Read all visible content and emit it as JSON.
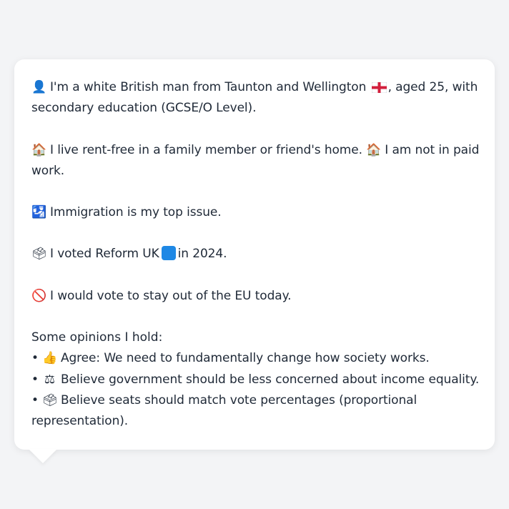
{
  "card": {
    "identity": {
      "icon": "bust-in-silhouette-icon",
      "glyph": "👤",
      "text_before_flag": "I'm a white British man from Taunton and Wellington",
      "flag": "england-flag-icon",
      "text_after_flag": ", aged 25, with secondary education (GCSE/O Level)."
    },
    "housing": {
      "icon": "house-icon",
      "glyph": "🏠",
      "text": "I live rent-free in a family member or friend's home.",
      "icon2": "house-icon",
      "glyph2": "🏠",
      "text2": "I am not in paid work."
    },
    "issue": {
      "icon": "passport-control-icon",
      "glyph": "🛂",
      "text": "Immigration is my top issue."
    },
    "vote": {
      "icon": "ballot-box-icon",
      "glyph": "🗳",
      "text_before": "I voted Reform UK",
      "party_color": "#1e88e5",
      "text_after": "in 2024."
    },
    "eu": {
      "icon": "prohibited-icon",
      "glyph": "🚫",
      "text": "I would vote to stay out of the EU today."
    },
    "opinions_intro": "Some opinions I hold:",
    "opinions": [
      {
        "bullet": "•",
        "icon": "thumbs-up-icon",
        "glyph": "👍",
        "text": "Agree: We need to fundamentally change how society works."
      },
      {
        "bullet": "•",
        "icon": "scales-icon",
        "glyph": "⚖",
        "text": "Believe government should be less concerned about income equality."
      },
      {
        "bullet": "•",
        "icon": "ballot-box-icon",
        "glyph": "🗳",
        "text": "Believe seats should match vote percentages (proportional representation)."
      }
    ]
  },
  "colors": {
    "background": "#f3f4f6",
    "card": "#ffffff",
    "text": "#1f2937"
  }
}
